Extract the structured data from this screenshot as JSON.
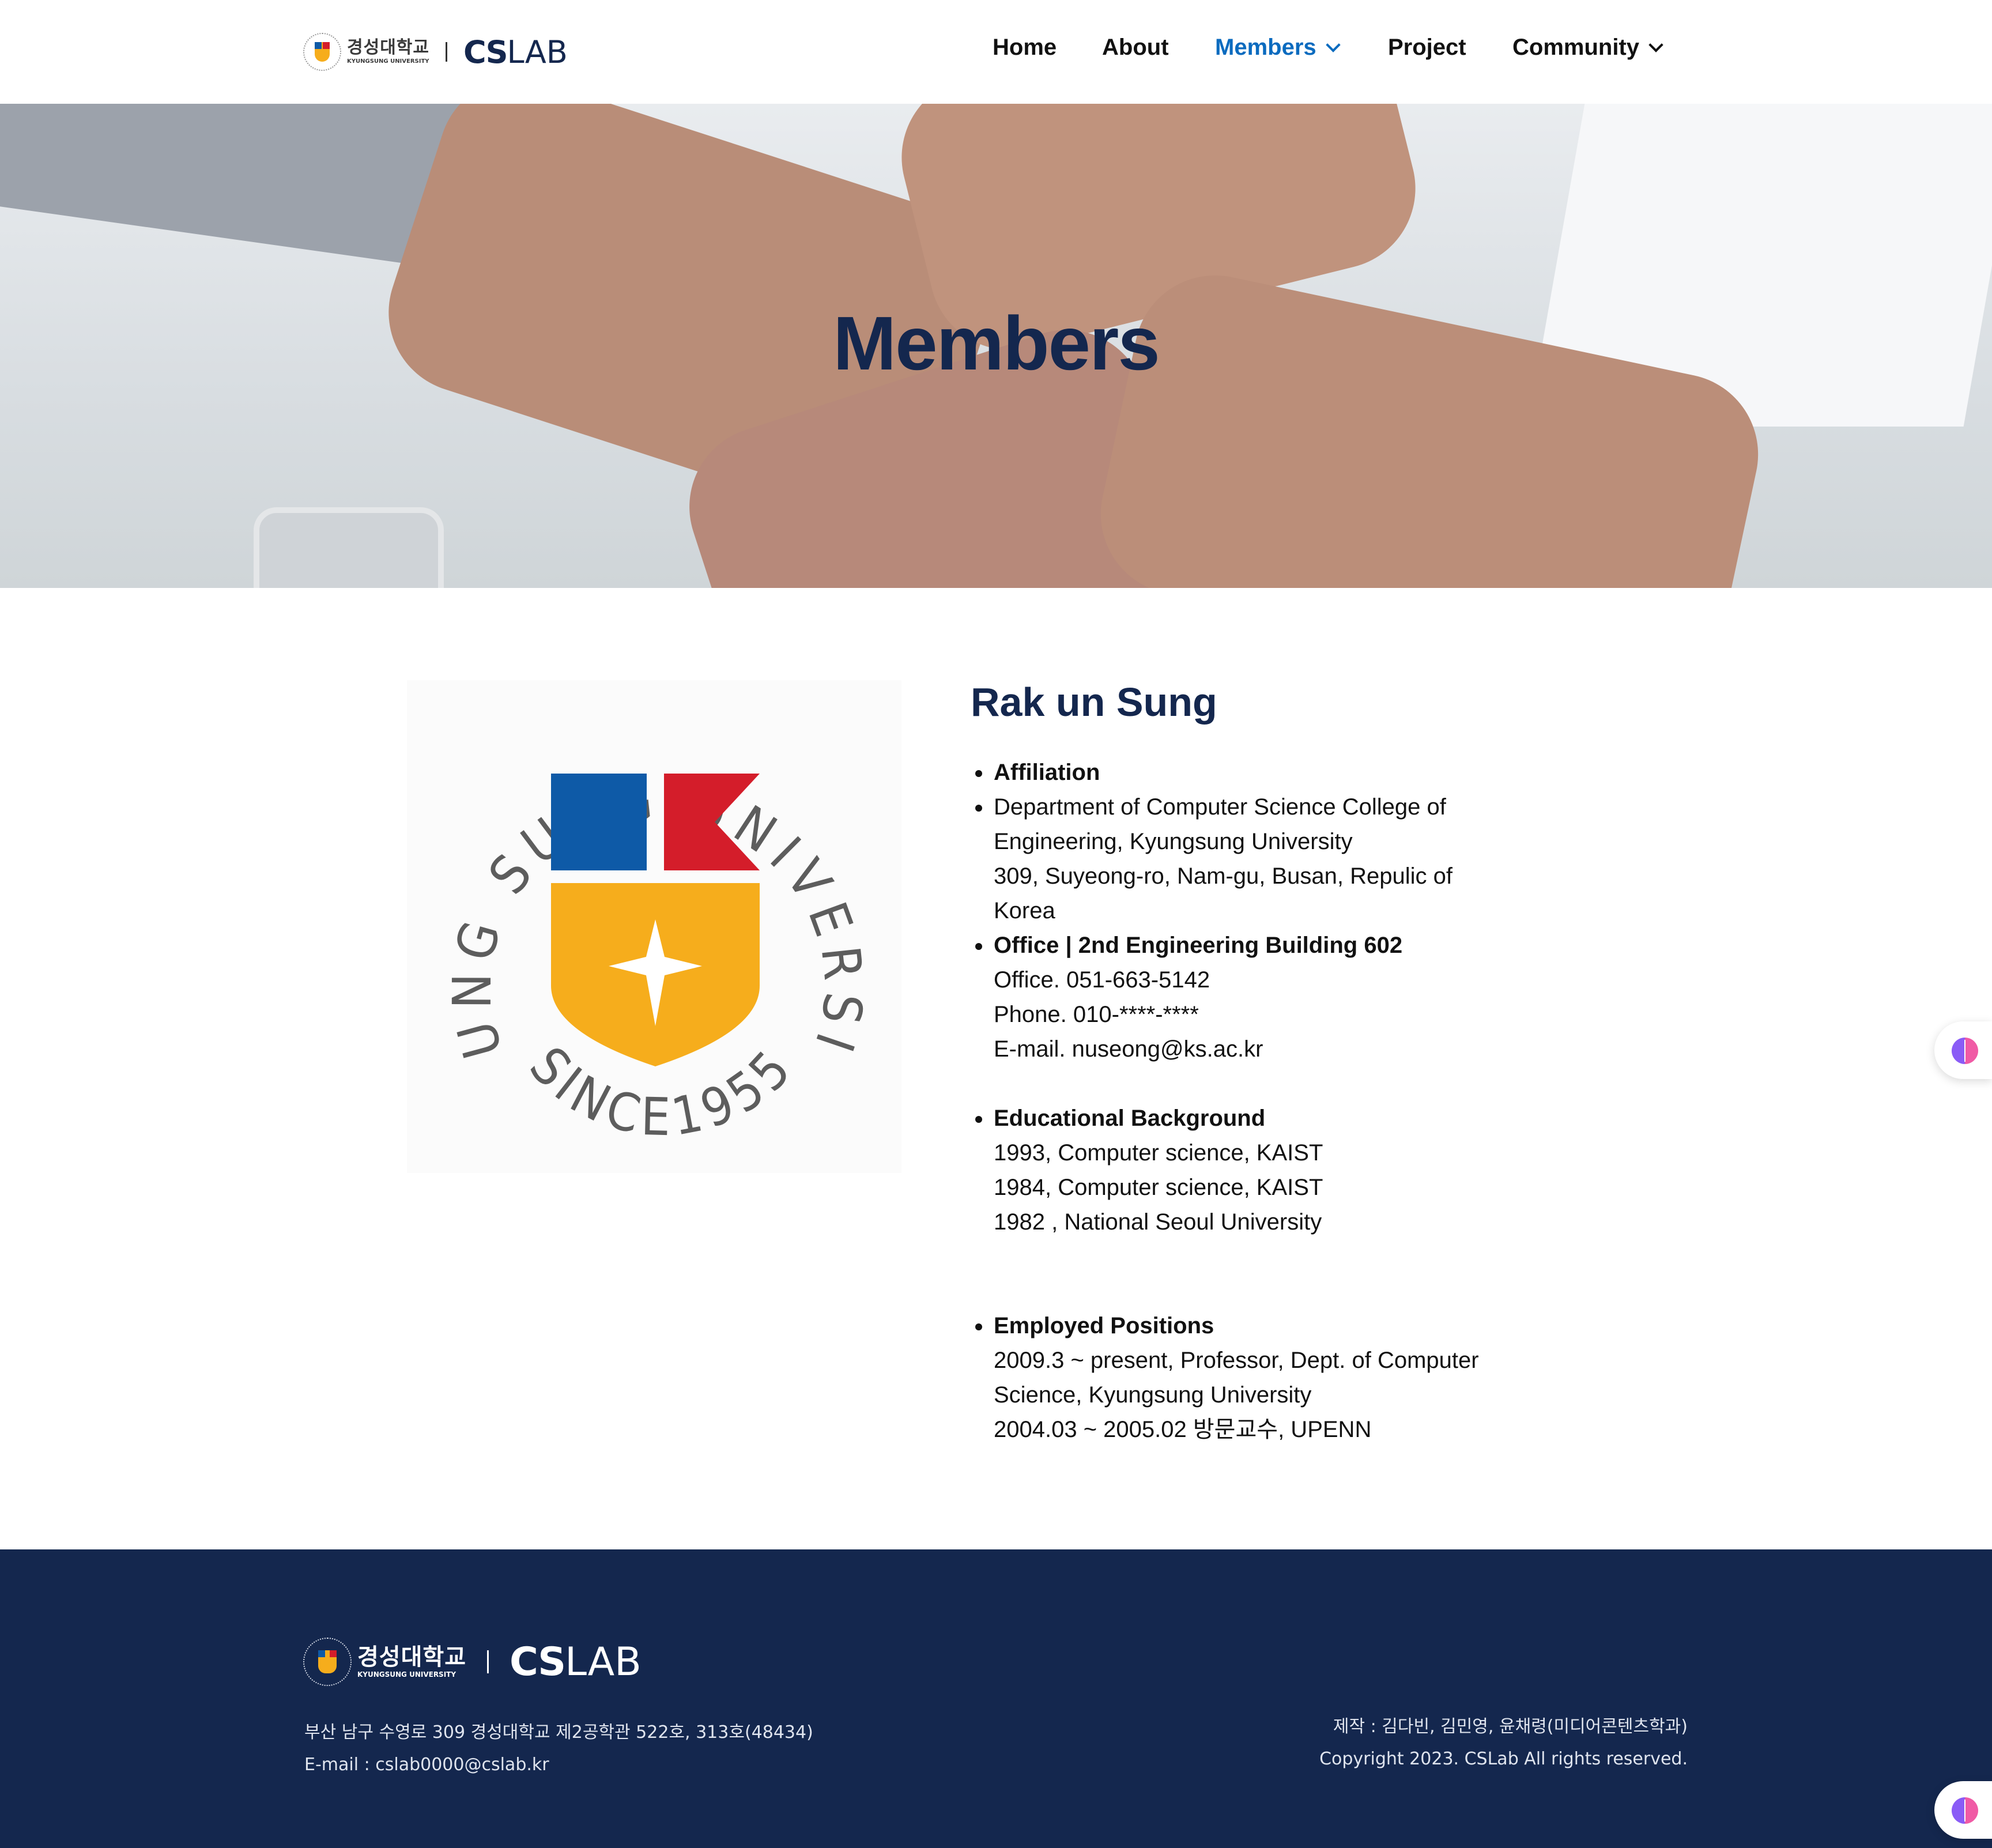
{
  "header": {
    "logo": {
      "uni_ko": "경성대학교",
      "uni_en": "KYUNGSUNG UNIVERSITY",
      "lab_cs": "CS",
      "lab_lab": "LAB"
    },
    "nav": [
      {
        "label": "Home"
      },
      {
        "label": "About"
      },
      {
        "label": "Members"
      },
      {
        "label": "Project"
      },
      {
        "label": "Community"
      }
    ]
  },
  "hero": {
    "title": "Members"
  },
  "profile": {
    "image_texts": {
      "arc_top": "KYUNG SUNG UNIVERSITY",
      "since": "SINCE1955"
    },
    "name": "Rak un Sung",
    "affiliation_heading": "Affiliation",
    "department_line1": "Department of Computer Science College of",
    "department_line2": "Engineering, Kyungsung University",
    "address_line1": "309, Suyeong-ro, Nam-gu, Busan, Repulic of",
    "address_line2": "Korea",
    "office_heading": "Office |  2nd Engineering Building 602",
    "office_phone": "Office. 051-663-5142",
    "phone": "Phone. 010-****-****",
    "email": "E-mail. nuseong@ks.ac.kr",
    "education_heading": "Educational Background",
    "education": [
      "1993, Computer science, KAIST",
      "1984, Computer science, KAIST",
      "1982 , National Seoul University"
    ],
    "employment_heading": "Employed Positions",
    "employment_line1": "2009.3 ~ present, Professor, Dept. of Computer",
    "employment_line2": "Science, Kyungsung University",
    "employment_line3": "2004.03 ~ 2005.02 방문교수, UPENN"
  },
  "footer": {
    "logo": {
      "uni_ko": "경성대학교",
      "uni_en": "KYUNGSUNG UNIVERSITY",
      "lab_cs": "CS",
      "lab_lab": "LAB"
    },
    "address": "부산 남구 수영로 309 경성대학교 제2공학관 522호, 313호(48434)",
    "email": "E-mail : cslab0000@cslab.kr",
    "credits": "제작 : 김다빈, 김민영, 윤채령(미디어콘텐츠학과)",
    "copyright": "Copyright 2023. CSLab All rights reserved."
  },
  "colors": {
    "navy": "#14274e",
    "accent_blue": "#0b6bbf",
    "seal_blue": "#0e5aa7",
    "seal_red": "#d41d2a",
    "seal_yellow": "#f6ad1c"
  },
  "icons": [
    "brain-widget-icon",
    "chevron-down-icon"
  ]
}
